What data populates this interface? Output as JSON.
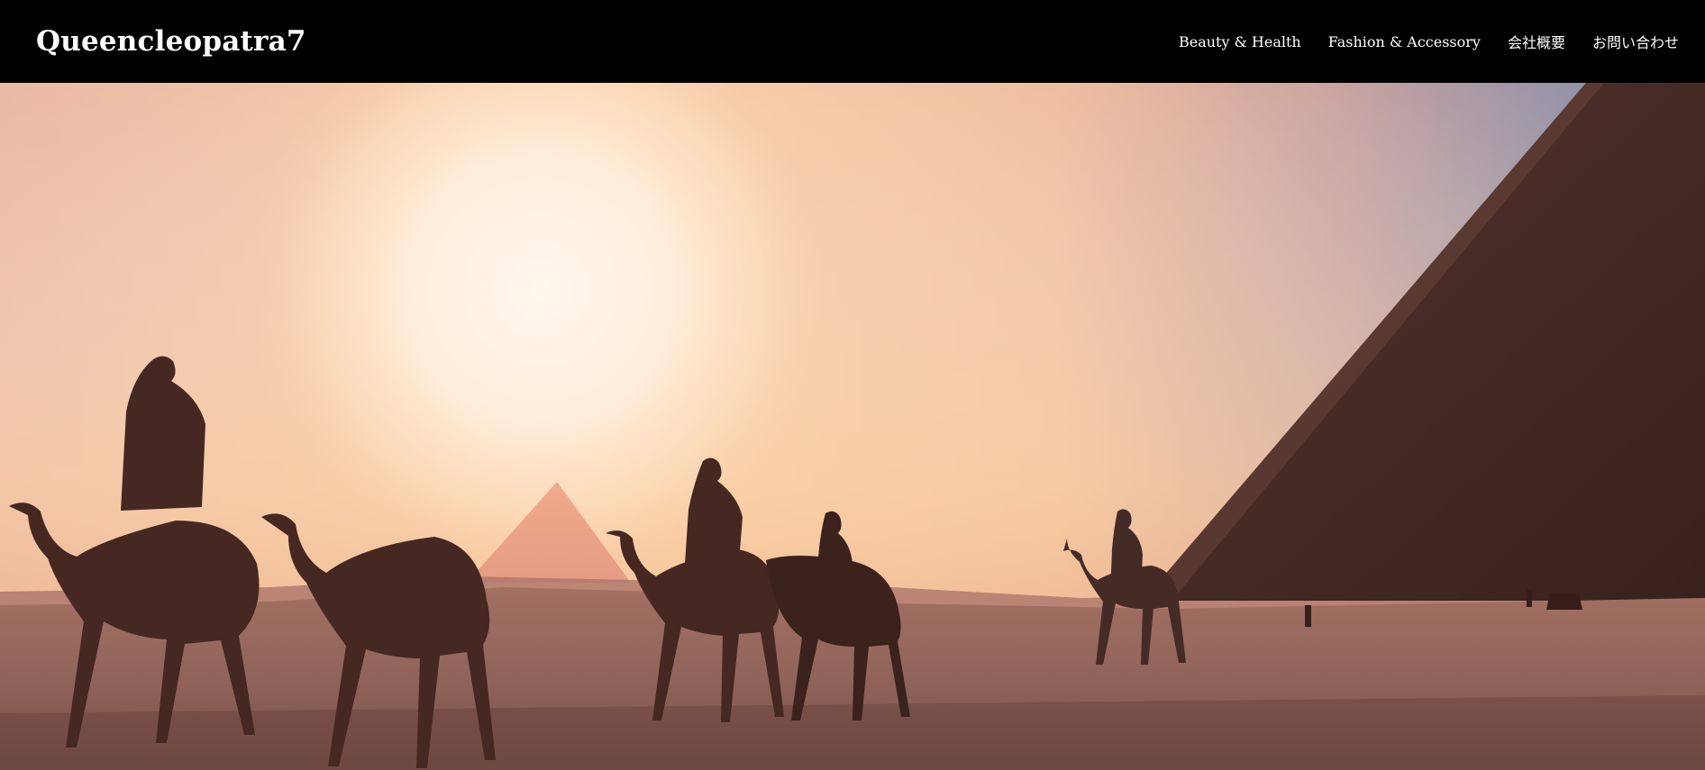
{
  "site": {
    "title": "Queencleopatra7"
  },
  "nav": {
    "items": [
      {
        "label": "Beauty & Health"
      },
      {
        "label": "Fashion & Accessory"
      },
      {
        "label": "会社概要"
      },
      {
        "label": "お問い合わせ"
      }
    ]
  },
  "hero": {
    "image": "camel-caravan-pyramids-sunset-photo",
    "colors": {
      "sky_warm": "#f6c9a6",
      "sun": "#fff6ea",
      "sky_cool": "#7d8fb2",
      "ground": "#8a5e56",
      "silhouette": "#2a1614"
    }
  }
}
